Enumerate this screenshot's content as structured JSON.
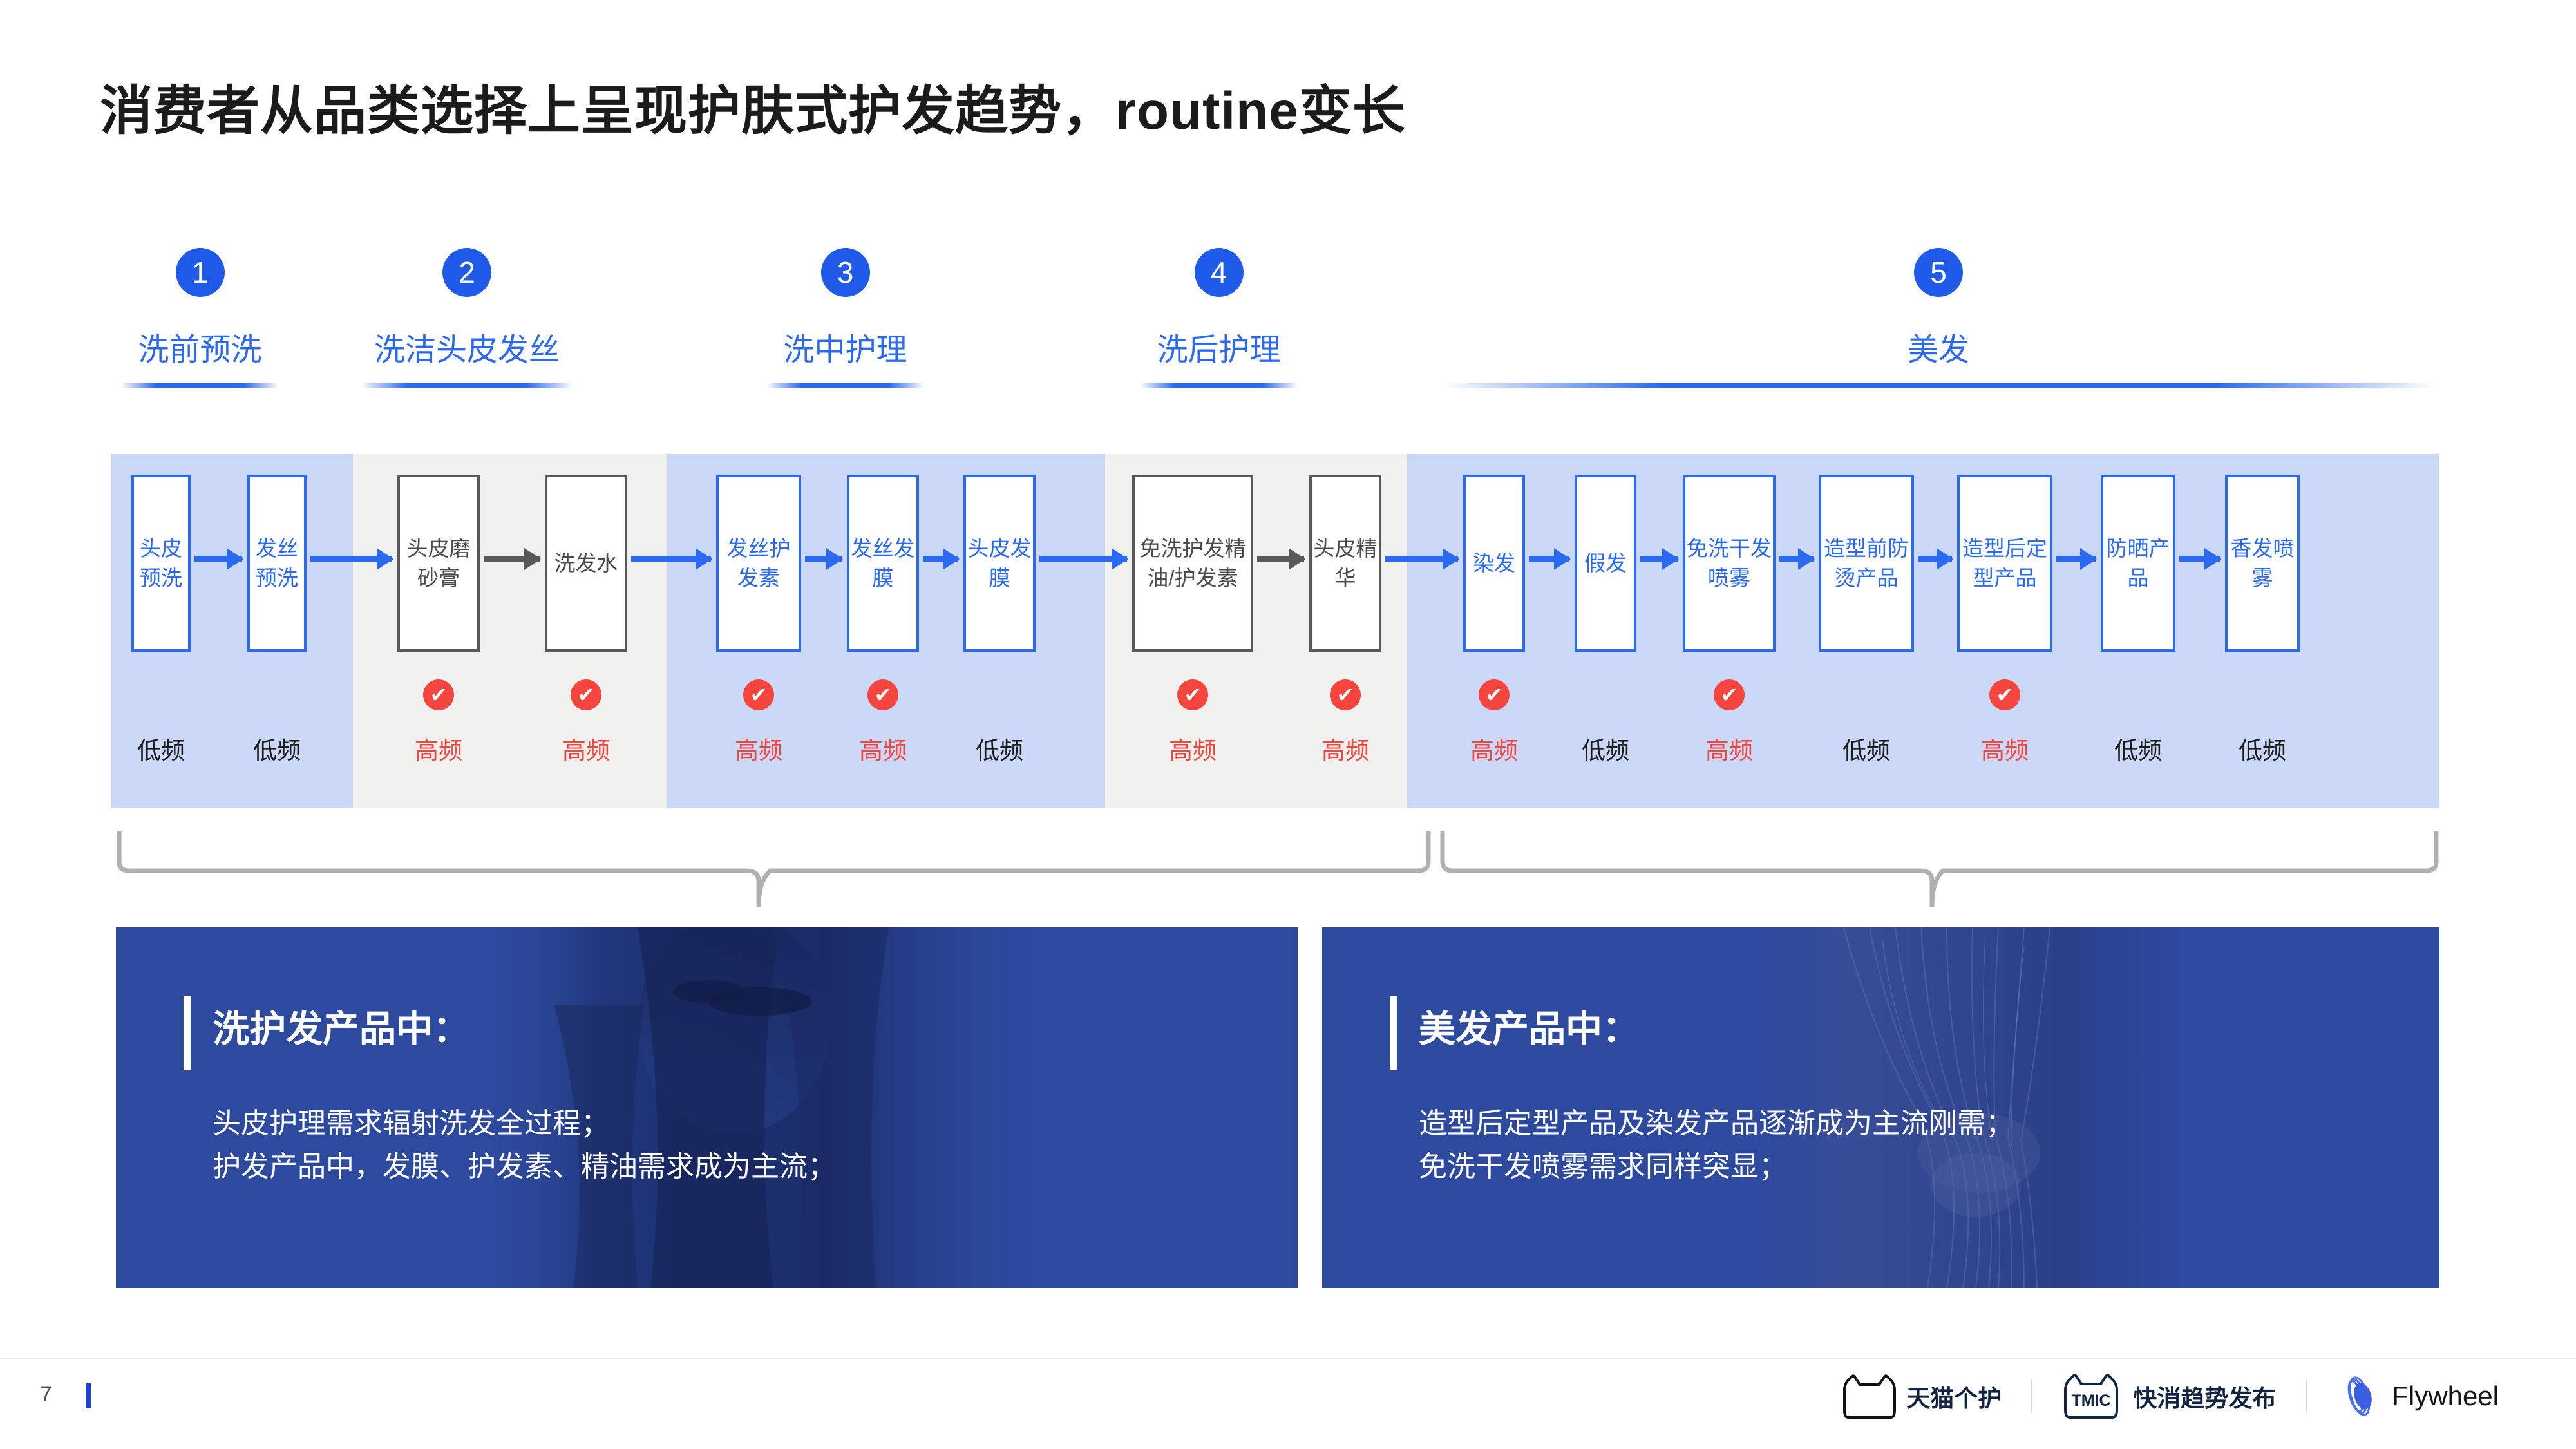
{
  "page": {
    "title": "消费者从品类选择上呈现护肤式护发趋势，routine变长",
    "number": "7"
  },
  "colors": {
    "accent_blue": "#2b6af0",
    "badge_blue": "#1f5ae8",
    "band_blue": "#ccd8f8",
    "band_gray": "#f0f0ef",
    "high_freq_red": "#f4453f",
    "card_blue": "#2e4a9e",
    "box_gray": "#59595b"
  },
  "stages": [
    {
      "number": "1",
      "label": "洗前预洗"
    },
    {
      "number": "2",
      "label": "洗洁头皮发丝"
    },
    {
      "number": "3",
      "label": "洗中护理"
    },
    {
      "number": "4",
      "label": "洗后护理"
    },
    {
      "number": "5",
      "label": "美发"
    }
  ],
  "flow": {
    "check_icon": "✔",
    "products": [
      {
        "name": "头皮预洗",
        "freq": "低频",
        "high": false,
        "style": "blue",
        "band": "blue"
      },
      {
        "name": "发丝预洗",
        "freq": "低频",
        "high": false,
        "style": "blue",
        "band": "blue"
      },
      {
        "name": "头皮磨砂膏",
        "freq": "高频",
        "high": true,
        "style": "gray",
        "band": "gray"
      },
      {
        "name": "洗发水",
        "freq": "高频",
        "high": true,
        "style": "gray",
        "band": "gray"
      },
      {
        "name": "发丝护发素",
        "freq": "高频",
        "high": true,
        "style": "blue",
        "band": "blue"
      },
      {
        "name": "发丝发膜",
        "freq": "高频",
        "high": true,
        "style": "blue",
        "band": "blue"
      },
      {
        "name": "头皮发膜",
        "freq": "低频",
        "high": false,
        "style": "blue",
        "band": "blue"
      },
      {
        "name": "免洗护发精油/护发素",
        "freq": "高频",
        "high": true,
        "style": "gray",
        "band": "gray"
      },
      {
        "name": "头皮精华",
        "freq": "高频",
        "high": true,
        "style": "gray",
        "band": "gray"
      },
      {
        "name": "染发",
        "freq": "高频",
        "high": true,
        "style": "blue",
        "band": "blue"
      },
      {
        "name": "假发",
        "freq": "低频",
        "high": false,
        "style": "blue",
        "band": "blue"
      },
      {
        "name": "免洗干发喷雾",
        "freq": "高频",
        "high": true,
        "style": "blue",
        "band": "blue"
      },
      {
        "name": "造型前防烫产品",
        "freq": "低频",
        "high": false,
        "style": "blue",
        "band": "blue"
      },
      {
        "name": "造型后定型产品",
        "freq": "高频",
        "high": true,
        "style": "blue",
        "band": "blue"
      },
      {
        "name": "防晒产品",
        "freq": "低频",
        "high": false,
        "style": "blue",
        "band": "blue"
      },
      {
        "name": "香发喷雾",
        "freq": "低频",
        "high": false,
        "style": "blue",
        "band": "blue"
      }
    ]
  },
  "cards": [
    {
      "heading": "洗护发产品中：",
      "lines": [
        "头皮护理需求辐射洗发全过程；",
        "护发产品中，发膜、护发素、精油需求成为主流；"
      ]
    },
    {
      "heading": "美发产品中：",
      "lines": [
        "造型后定型产品及染发产品逐渐成为主流刚需；",
        "免洗干发喷雾需求同样突显；"
      ]
    }
  ],
  "footer": {
    "logos": [
      {
        "icon": "tmall-cat-icon",
        "text": "天猫个护"
      },
      {
        "icon": "tmic-cat-icon",
        "text": "快消趋势发布"
      },
      {
        "icon": "flywheel-icon",
        "text": "Flywheel"
      }
    ]
  }
}
